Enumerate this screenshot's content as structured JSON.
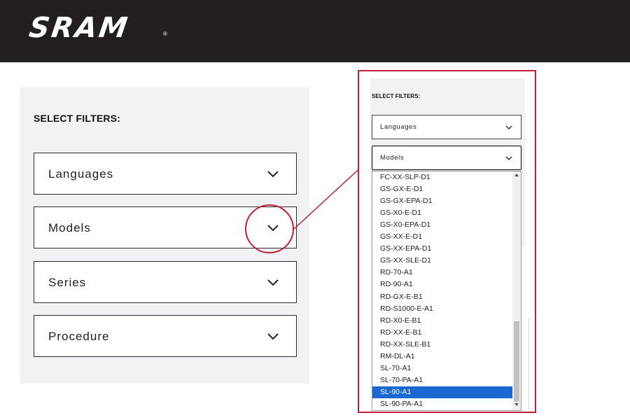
{
  "header": {
    "logo_text": "SRAM",
    "logo_mark": "®",
    "background": "#231f20"
  },
  "filters": {
    "title": "SELECT FILTERS:",
    "dropdowns": [
      {
        "label": "Languages"
      },
      {
        "label": "Models"
      },
      {
        "label": "Series"
      },
      {
        "label": "Procedure"
      }
    ]
  },
  "zoom": {
    "title": "SELECT FILTERS:",
    "dropdowns": [
      {
        "label": "Languages"
      },
      {
        "label": "Models"
      }
    ],
    "models_options": [
      "FC-XX-SLP-D1",
      "GS-GX-E-D1",
      "GS-GX-EPA-D1",
      "GS-X0-E-D1",
      "GS-X0-EPA-D1",
      "GS-XX-E-D1",
      "GS-XX-EPA-D1",
      "GS-XX-SLE-D1",
      "RD-70-A1",
      "RD-90-A1",
      "RD-GX-E-B1",
      "RD-S1000-E-A1",
      "RD-X0-E-B1",
      "RD-XX-E-B1",
      "RD-XX-SLE-B1",
      "RM-DL-A1",
      "SL-70-A1",
      "SL-70-PA-A1",
      "SL-90-A1",
      "SL-90-PA-A1"
    ],
    "selected_option": "SL-90-A1"
  },
  "colors": {
    "highlight": "#c21f3a",
    "selection": "#1a68d1",
    "panel": "#f1f2f3"
  },
  "icons": {
    "dropdown": "chevron-down-icon"
  }
}
